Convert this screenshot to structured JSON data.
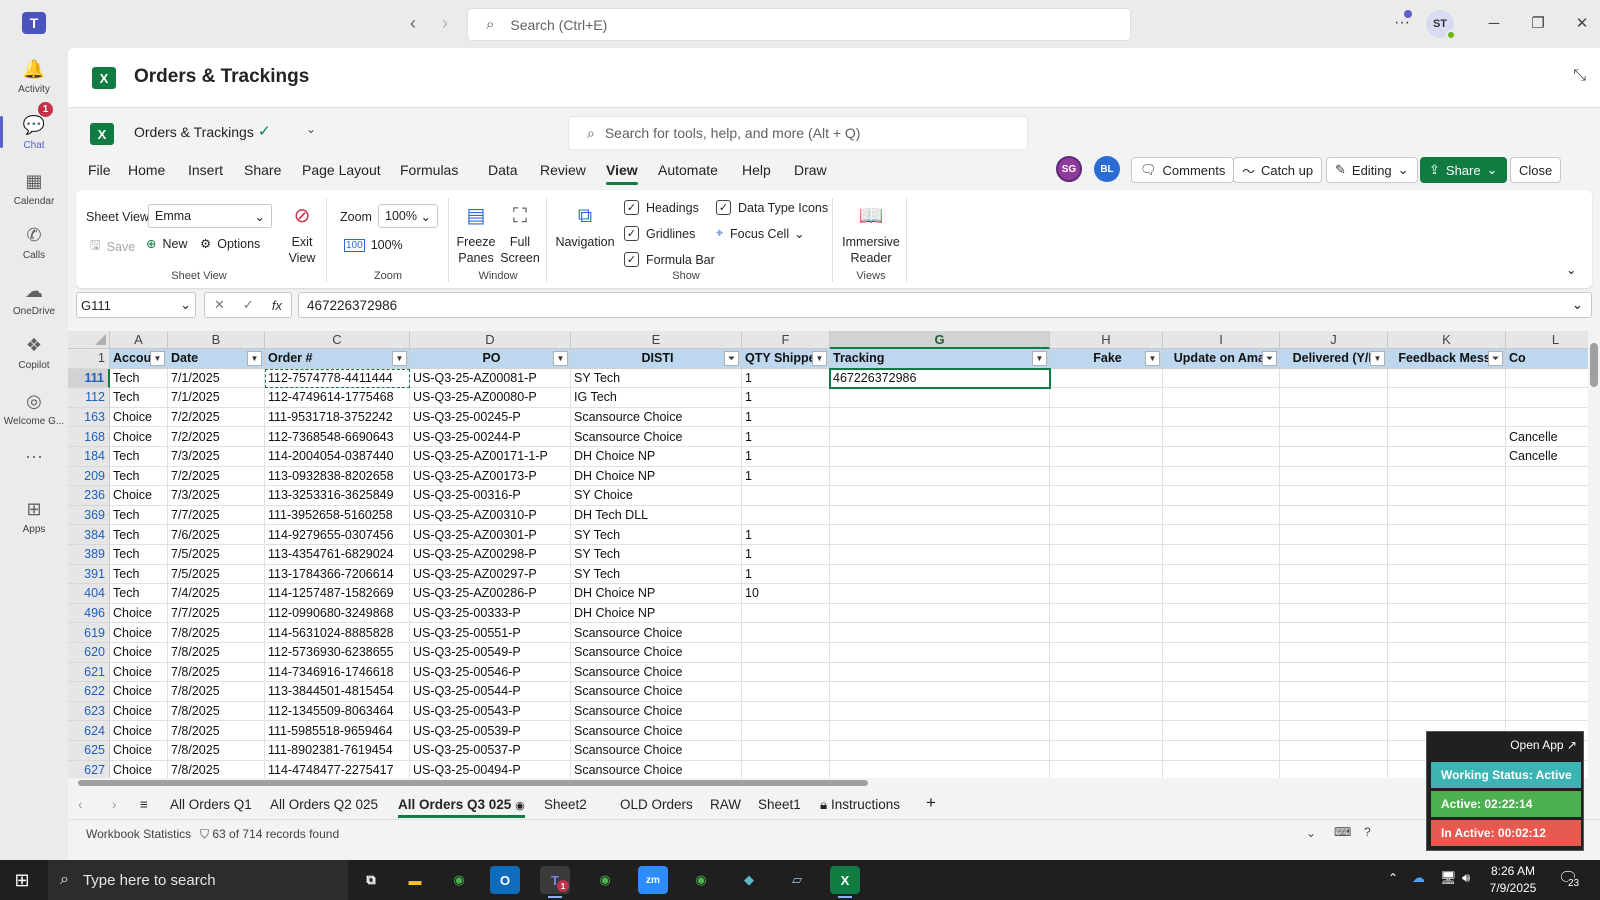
{
  "teams": {
    "search_placeholder": "Search (Ctrl+E)",
    "user_initials": "ST",
    "rail": [
      {
        "label": "Activity",
        "icon": "bell-icon",
        "badge": "1"
      },
      {
        "label": "Chat",
        "icon": "chat-icon"
      },
      {
        "label": "Calendar",
        "icon": "calendar-icon"
      },
      {
        "label": "Calls",
        "icon": "phone-icon"
      },
      {
        "label": "OneDrive",
        "icon": "cloud-icon"
      },
      {
        "label": "Copilot",
        "icon": "copilot-icon"
      },
      {
        "label": "Welcome G...",
        "icon": "welcome-icon"
      },
      {
        "label": "Apps",
        "icon": "add-apps-icon"
      }
    ]
  },
  "app": {
    "title": "Orders & Trackings"
  },
  "excel": {
    "workbook_name": "Orders & Trackings",
    "search_placeholder": "Search for tools, help, and more (Alt + Q)",
    "menu": [
      "File",
      "Home",
      "Insert",
      "Share",
      "Page Layout",
      "Formulas",
      "Data",
      "Review",
      "View",
      "Automate",
      "Help",
      "Draw"
    ],
    "active_menu": "View",
    "collaborators": [
      "SG",
      "BL"
    ],
    "buttons": {
      "comments": "Comments",
      "catch_up": "Catch up",
      "editing": "Editing",
      "share": "Share",
      "close": "Close"
    },
    "ribbon": {
      "sheet_view_label": "Sheet View",
      "sheet_view_value": "Emma",
      "save": "Save",
      "new": "New",
      "options": "Options",
      "exit_view": "Exit View",
      "group_sheet_view": "Sheet View",
      "zoom_label": "Zoom",
      "zoom_value": "100%",
      "zoom_100": "100%",
      "group_zoom": "Zoom",
      "freeze_panes": "Freeze Panes",
      "full_screen": "Full Screen",
      "group_window": "Window",
      "navigation": "Navigation",
      "headings": "Headings",
      "gridlines": "Gridlines",
      "formula_bar": "Formula Bar",
      "data_type_icons": "Data Type Icons",
      "focus_cell": "Focus Cell",
      "group_show": "Show",
      "immersive_reader": "Immersive Reader",
      "group_views": "Views"
    },
    "name_box": "G111",
    "formula_value": "467226372986",
    "columns": [
      {
        "letter": "A",
        "header": "Accou",
        "filter": "dropdown"
      },
      {
        "letter": "B",
        "header": "Date",
        "filter": "dropdown"
      },
      {
        "letter": "C",
        "header": "Order #",
        "filter": "dropdown"
      },
      {
        "letter": "D",
        "header": "PO",
        "filter": "dropdown"
      },
      {
        "letter": "E",
        "header": "DISTI",
        "filter": "filtered"
      },
      {
        "letter": "F",
        "header": "QTY Shipped",
        "filter": "dropdown"
      },
      {
        "letter": "G",
        "header": "Tracking",
        "filter": "dropdown"
      },
      {
        "letter": "H",
        "header": "Fake",
        "filter": "dropdown"
      },
      {
        "letter": "I",
        "header": "Update on Amaz",
        "filter": "filtered"
      },
      {
        "letter": "J",
        "header": "Delivered (Y/N",
        "filter": "dropdown"
      },
      {
        "letter": "K",
        "header": "Feedback Messa",
        "filter": "filtered"
      },
      {
        "letter": "L",
        "header": "Co",
        "filter": "none"
      }
    ],
    "rows": [
      {
        "num": "111",
        "cells": [
          "Tech",
          "7/1/2025",
          "112-7574778-4411444",
          "US-Q3-25-AZ00081-P",
          "SY Tech",
          "1",
          "467226372986",
          "",
          "",
          "",
          "",
          ""
        ]
      },
      {
        "num": "112",
        "cells": [
          "Tech",
          "7/1/2025",
          "112-4749614-1775468",
          "US-Q3-25-AZ00080-P",
          "IG Tech",
          "1",
          "",
          "",
          "",
          "",
          "",
          ""
        ]
      },
      {
        "num": "163",
        "cells": [
          "Choice",
          "7/2/2025",
          "111-9531718-3752242",
          "US-Q3-25-00245-P",
          "Scansource Choice",
          "1",
          "",
          "",
          "",
          "",
          "",
          ""
        ]
      },
      {
        "num": "168",
        "cells": [
          "Choice",
          "7/2/2025",
          "112-7368548-6690643",
          "US-Q3-25-00244-P",
          "Scansource Choice",
          "1",
          "",
          "",
          "",
          "",
          "",
          "Cancelle"
        ]
      },
      {
        "num": "184",
        "cells": [
          "Tech",
          "7/3/2025",
          "114-2004054-0387440",
          "US-Q3-25-AZ00171-1-P",
          "DH Choice NP",
          "1",
          "",
          "",
          "",
          "",
          "",
          "Cancelle"
        ]
      },
      {
        "num": "209",
        "cells": [
          "Tech",
          "7/2/2025",
          "113-0932838-8202658",
          "US-Q3-25-AZ00173-P",
          "DH Choice NP",
          "1",
          "",
          "",
          "",
          "",
          "",
          ""
        ]
      },
      {
        "num": "236",
        "cells": [
          "Choice",
          "7/3/2025",
          "113-3253316-3625849",
          "US-Q3-25-00316-P",
          "SY Choice",
          "",
          "",
          "",
          "",
          "",
          "",
          ""
        ]
      },
      {
        "num": "369",
        "cells": [
          "Tech",
          "7/7/2025",
          "111-3952658-5160258",
          "US-Q3-25-AZ00310-P",
          "DH Tech DLL",
          "",
          "",
          "",
          "",
          "",
          "",
          ""
        ]
      },
      {
        "num": "384",
        "cells": [
          "Tech",
          "7/6/2025",
          "114-9279655-0307456",
          "US-Q3-25-AZ00301-P",
          "SY Tech",
          "1",
          "",
          "",
          "",
          "",
          "",
          ""
        ]
      },
      {
        "num": "389",
        "cells": [
          "Tech",
          "7/5/2025",
          "113-4354761-6829024",
          "US-Q3-25-AZ00298-P",
          "SY Tech",
          "1",
          "",
          "",
          "",
          "",
          "",
          ""
        ]
      },
      {
        "num": "391",
        "cells": [
          "Tech",
          "7/5/2025",
          "113-1784366-7206614",
          "US-Q3-25-AZ00297-P",
          "SY Tech",
          "1",
          "",
          "",
          "",
          "",
          "",
          ""
        ]
      },
      {
        "num": "404",
        "cells": [
          "Tech",
          "7/4/2025",
          "114-1257487-1582669",
          "US-Q3-25-AZ00286-P",
          "DH Choice NP",
          "10",
          "",
          "",
          "",
          "",
          "",
          ""
        ]
      },
      {
        "num": "496",
        "cells": [
          "Choice",
          "7/7/2025",
          "112-0990680-3249868",
          "US-Q3-25-00333-P",
          "DH Choice NP",
          "",
          "",
          "",
          "",
          "",
          "",
          ""
        ]
      },
      {
        "num": "619",
        "cells": [
          "Choice",
          "7/8/2025",
          "114-5631024-8885828",
          "US-Q3-25-00551-P",
          "Scansource Choice",
          "",
          "",
          "",
          "",
          "",
          "",
          ""
        ]
      },
      {
        "num": "620",
        "cells": [
          "Choice",
          "7/8/2025",
          "112-5736930-6238655",
          "US-Q3-25-00549-P",
          "Scansource Choice",
          "",
          "",
          "",
          "",
          "",
          "",
          ""
        ]
      },
      {
        "num": "621",
        "cells": [
          "Choice",
          "7/8/2025",
          "114-7346916-1746618",
          "US-Q3-25-00546-P",
          "Scansource Choice",
          "",
          "",
          "",
          "",
          "",
          "",
          ""
        ]
      },
      {
        "num": "622",
        "cells": [
          "Choice",
          "7/8/2025",
          "113-3844501-4815454",
          "US-Q3-25-00544-P",
          "Scansource Choice",
          "",
          "",
          "",
          "",
          "",
          "",
          ""
        ]
      },
      {
        "num": "623",
        "cells": [
          "Choice",
          "7/8/2025",
          "112-1345509-8063464",
          "US-Q3-25-00543-P",
          "Scansource Choice",
          "",
          "",
          "",
          "",
          "",
          "",
          ""
        ]
      },
      {
        "num": "624",
        "cells": [
          "Choice",
          "7/8/2025",
          "111-5985518-9659464",
          "US-Q3-25-00539-P",
          "Scansource Choice",
          "",
          "",
          "",
          "",
          "",
          "",
          ""
        ]
      },
      {
        "num": "625",
        "cells": [
          "Choice",
          "7/8/2025",
          "111-8902381-7619454",
          "US-Q3-25-00537-P",
          "Scansource Choice",
          "",
          "",
          "",
          "",
          "",
          "",
          ""
        ]
      },
      {
        "num": "627",
        "cells": [
          "Choice",
          "7/8/2025",
          "114-4748477-2275417",
          "US-Q3-25-00494-P",
          "Scansource Choice",
          "",
          "",
          "",
          "",
          "",
          "",
          ""
        ]
      }
    ],
    "sheets": [
      "All Orders Q1",
      "All Orders Q2 025",
      "All Orders Q3 025",
      "Sheet2",
      "OLD Orders",
      "RAW",
      "Sheet1",
      "Instructions"
    ],
    "active_sheet": "All Orders Q3 025",
    "status": {
      "workbook_stats": "Workbook Statistics",
      "records": "63 of 714 records found"
    }
  },
  "widget": {
    "open_app": "Open App ↗",
    "working_status": "Working Status: Active",
    "active_time": "Active: 02:22:14",
    "inactive_time": "In Active: 00:02:12",
    "colors": {
      "status": "#3cb4b4",
      "active": "#4caf50",
      "inactive": "#e85a4f"
    }
  },
  "taskbar": {
    "search_placeholder": "Type here to search",
    "time": "8:26 AM",
    "date": "7/9/2025",
    "notifications": "23",
    "teams_badge": "1"
  }
}
